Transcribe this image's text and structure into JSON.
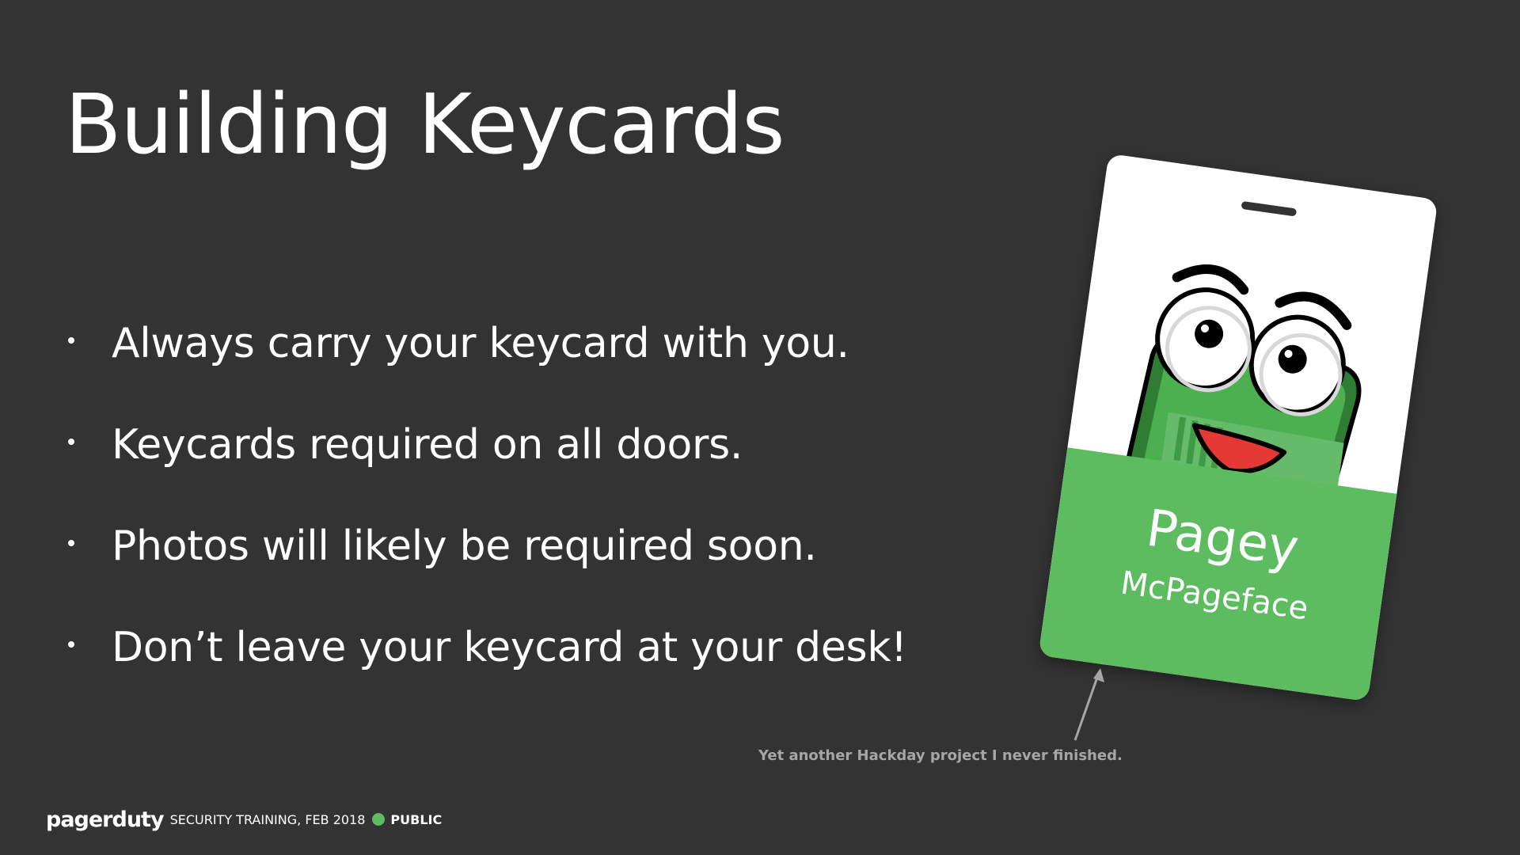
{
  "slide": {
    "title": "Building Keycards",
    "bullets": [
      "Always carry your keycard with you.",
      "Keycards required on all doors.",
      "Photos will likely be required soon.",
      "Don’t leave your keycard at your desk!"
    ]
  },
  "keycard": {
    "first_name": "Pagey",
    "last_name": "McPageface",
    "band_color": "#5cbc5f",
    "mascot_icon": "pagey-mascot-icon"
  },
  "caption": "Yet another Hackday project I never finished.",
  "footer": {
    "brand": "pagerduty",
    "text": "SECURITY TRAINING, FEB 2018",
    "status_label": "PUBLIC",
    "status_color": "#5cbc5f"
  },
  "colors": {
    "background": "#333333",
    "text": "#ffffff",
    "caption": "#a6a6a6",
    "accent": "#5cbc5f"
  }
}
